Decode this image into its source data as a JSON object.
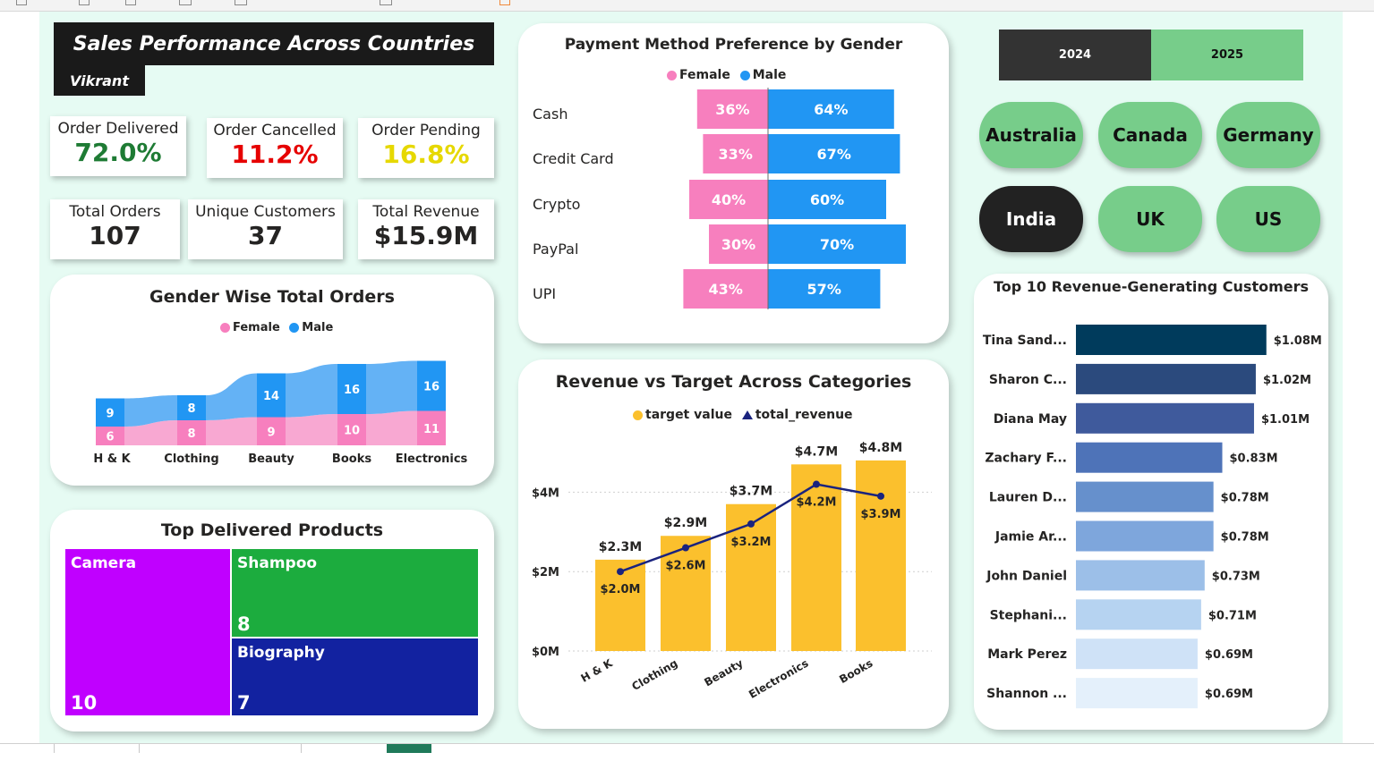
{
  "header": {
    "title": "Sales Performance Across Countries",
    "author": "Vikrant"
  },
  "kpis": [
    {
      "label": "Order Delivered",
      "value": "72.0%",
      "color": "#1e7b34"
    },
    {
      "label": "Order Cancelled",
      "value": "11.2%",
      "color": "#e60000"
    },
    {
      "label": "Order Pending",
      "value": "16.8%",
      "color": "#e6d800"
    },
    {
      "label": "Total Orders",
      "value": "107",
      "color": "#252423"
    },
    {
      "label": "Unique Customers",
      "value": "37",
      "color": "#252423"
    },
    {
      "label": "Total Revenue",
      "value": "$15.9M",
      "color": "#252423"
    }
  ],
  "slicers": {
    "years": [
      {
        "label": "2024",
        "selected": true
      },
      {
        "label": "2025",
        "selected": false
      }
    ],
    "countries": [
      {
        "label": "Australia",
        "selected": false
      },
      {
        "label": "Canada",
        "selected": false
      },
      {
        "label": "Germany",
        "selected": false
      },
      {
        "label": "India",
        "selected": true
      },
      {
        "label": "UK",
        "selected": false
      },
      {
        "label": "US",
        "selected": false
      }
    ]
  },
  "colors": {
    "female": "#f77fbe",
    "male": "#2196f3",
    "target": "#fbc02d",
    "revenue_line": "#1a237e",
    "slicer_on": "#222222",
    "slicer_off": "#77cd8a",
    "year_on": "#333333"
  },
  "chart_data": [
    {
      "id": "gender_orders",
      "type": "area",
      "stacked": true,
      "title": "Gender Wise Total Orders",
      "categories": [
        "H & K",
        "Clothing",
        "Beauty",
        "Books",
        "Electronics"
      ],
      "series": [
        {
          "name": "Female",
          "values": [
            6,
            8,
            9,
            10,
            11
          ]
        },
        {
          "name": "Male",
          "values": [
            9,
            8,
            14,
            16,
            16
          ]
        }
      ],
      "legend": "top-center"
    },
    {
      "id": "payment_gender",
      "type": "bar",
      "orientation": "horizontal",
      "diverging": true,
      "title": "Payment Method Preference by Gender",
      "categories": [
        "Cash",
        "Credit Card",
        "Crypto",
        "PayPal",
        "UPI"
      ],
      "series": [
        {
          "name": "Female",
          "values": [
            36,
            33,
            40,
            30,
            43
          ],
          "labels": [
            "36%",
            "33%",
            "40%",
            "30%",
            "43%"
          ]
        },
        {
          "name": "Male",
          "values": [
            64,
            67,
            60,
            70,
            57
          ],
          "labels": [
            "64%",
            "67%",
            "60%",
            "70%",
            "57%"
          ]
        }
      ],
      "legend": "top-center"
    },
    {
      "id": "revenue_target",
      "type": "bar",
      "title": "Revenue vs Target Across Categories",
      "categories": [
        "H & K",
        "Clothing",
        "Beauty",
        "Electronics",
        "Books"
      ],
      "series": [
        {
          "name": "target value",
          "type": "bar",
          "values": [
            2.3,
            2.9,
            3.7,
            4.7,
            4.8
          ],
          "labels": [
            "$2.3M",
            "$2.9M",
            "$3.7M",
            "$4.7M",
            "$4.8M"
          ]
        },
        {
          "name": "total_revenue",
          "type": "line",
          "values": [
            2.0,
            2.6,
            3.2,
            4.2,
            3.9
          ],
          "labels": [
            "$2.0M",
            "$2.6M",
            "$3.2M",
            "$4.2M",
            "$3.9M"
          ]
        }
      ],
      "yticks": [
        0,
        2,
        4
      ],
      "ytick_labels": [
        "$0M",
        "$2M",
        "$4M"
      ],
      "ylim": [
        0,
        5.0
      ],
      "grid": true,
      "legend": "top-center"
    },
    {
      "id": "top_customers",
      "type": "bar",
      "orientation": "horizontal",
      "title": "Top 10 Revenue-Generating Customers",
      "categories": [
        "Tina Sand...",
        "Sharon C...",
        "Diana May",
        "Zachary F...",
        "Lauren D...",
        "Jamie Ar...",
        "John Daniel",
        "Stephani...",
        "Mark Perez",
        "Shannon ..."
      ],
      "values": [
        1.08,
        1.02,
        1.01,
        0.83,
        0.78,
        0.78,
        0.73,
        0.71,
        0.69,
        0.69
      ],
      "labels": [
        "$1.08M",
        "$1.02M",
        "$1.01M",
        "$0.83M",
        "$0.78M",
        "$0.78M",
        "$0.73M",
        "$0.71M",
        "$0.69M",
        "$0.69M"
      ],
      "bar_colors": [
        "#003b5c",
        "#2b4a7d",
        "#3f5a9c",
        "#4e73b8",
        "#6690cc",
        "#7ea6dc",
        "#9cbfe8",
        "#b6d3f1",
        "#cfe2f7",
        "#e4f0fb"
      ]
    },
    {
      "id": "top_products",
      "type": "treemap",
      "title": "Top Delivered Products",
      "items": [
        {
          "name": "Camera",
          "value": 10,
          "color": "#c000ff"
        },
        {
          "name": "Shampoo",
          "value": 8,
          "color": "#1cac3e"
        },
        {
          "name": "Biography",
          "value": 7,
          "color": "#1222a0"
        }
      ]
    }
  ]
}
